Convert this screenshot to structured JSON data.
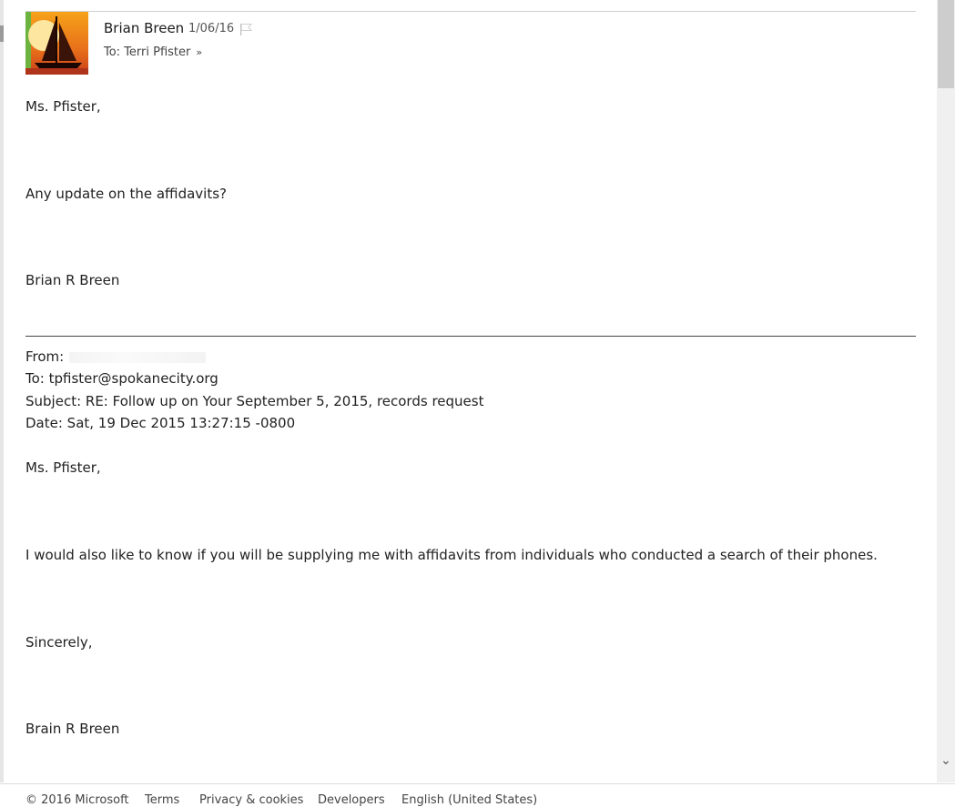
{
  "message": {
    "sender_name": "Brian Breen",
    "date": "1/06/16",
    "to_label": "To: Terri Pfister",
    "avatar_icon": "sailboat-sunset-avatar",
    "flag_icon": "flag-icon",
    "expand_icon": "double-chevron-down-icon",
    "body": {
      "greeting": "Ms. Pfister,",
      "question": "Any update on the affidavits?",
      "signature": "Brian R Breen"
    }
  },
  "quoted": {
    "from_label": "From:",
    "to_line": "To: tpfister@spokanecity.org",
    "subject_line": "Subject: RE: Follow up on Your September 5, 2015, records request",
    "date_line": "Date: Sat, 19 Dec 2015 13:27:15 -0800",
    "greeting": "Ms. Pfister,",
    "paragraph": "I would also like to know if you will be supplying me with affidavits from individuals who conducted a search of their phones.",
    "closing": "Sincerely,",
    "signature": "Brain R Breen"
  },
  "footer": {
    "copyright": "© 2016 Microsoft",
    "terms": "Terms",
    "privacy": "Privacy & cookies",
    "developers": "Developers",
    "language": "English (United States)"
  },
  "colors": {
    "text": "#222222",
    "muted": "#555555",
    "rule": "#444444"
  }
}
